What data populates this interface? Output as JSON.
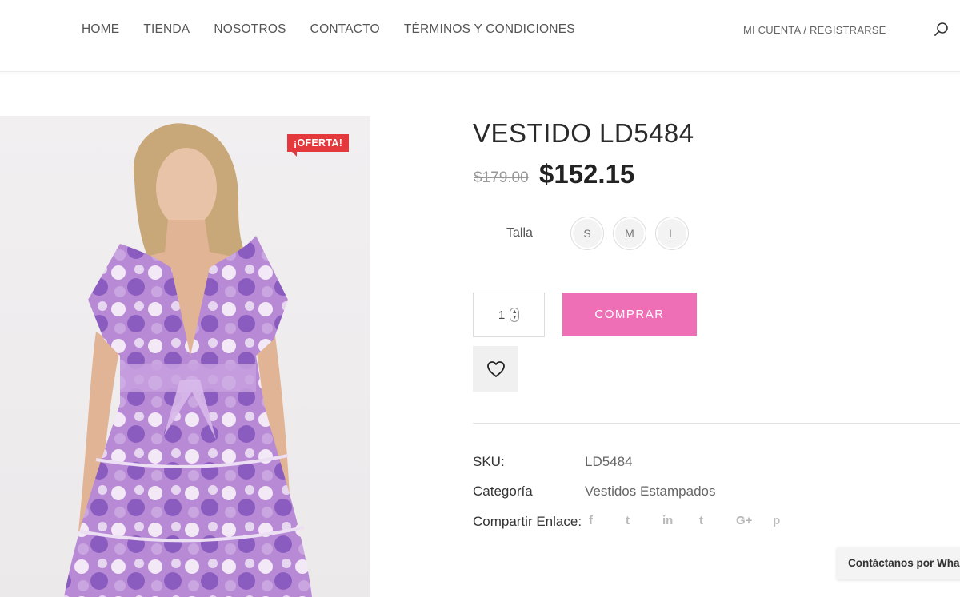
{
  "nav": {
    "items": [
      "HOME",
      "TIENDA",
      "NOSOTROS",
      "CONTACTO",
      "TÉRMINOS Y CONDICIONES"
    ],
    "account": "MI CUENTA / REGISTRARSE"
  },
  "product": {
    "badge": "¡OFERTA!",
    "title": "VESTIDO LD5484",
    "old_price": "$179.00",
    "new_price": "$152.15",
    "size_label": "Talla",
    "sizes": [
      "S",
      "M",
      "L"
    ],
    "quantity": "1",
    "buy_label": "COMPRAR",
    "sku_label": "SKU:",
    "sku_value": "LD5484",
    "category_label": "Categoría",
    "category_value": "Vestidos Estampados",
    "share_label": "Compartir Enlace:",
    "share_icons": [
      "f",
      "t",
      "in",
      "t",
      "G+",
      "p"
    ]
  },
  "whatsapp_label": "Contáctanos por Wha",
  "colors": {
    "accent": "#ef6fb6",
    "badge": "#e4393c",
    "dress": "#a77bc9"
  }
}
